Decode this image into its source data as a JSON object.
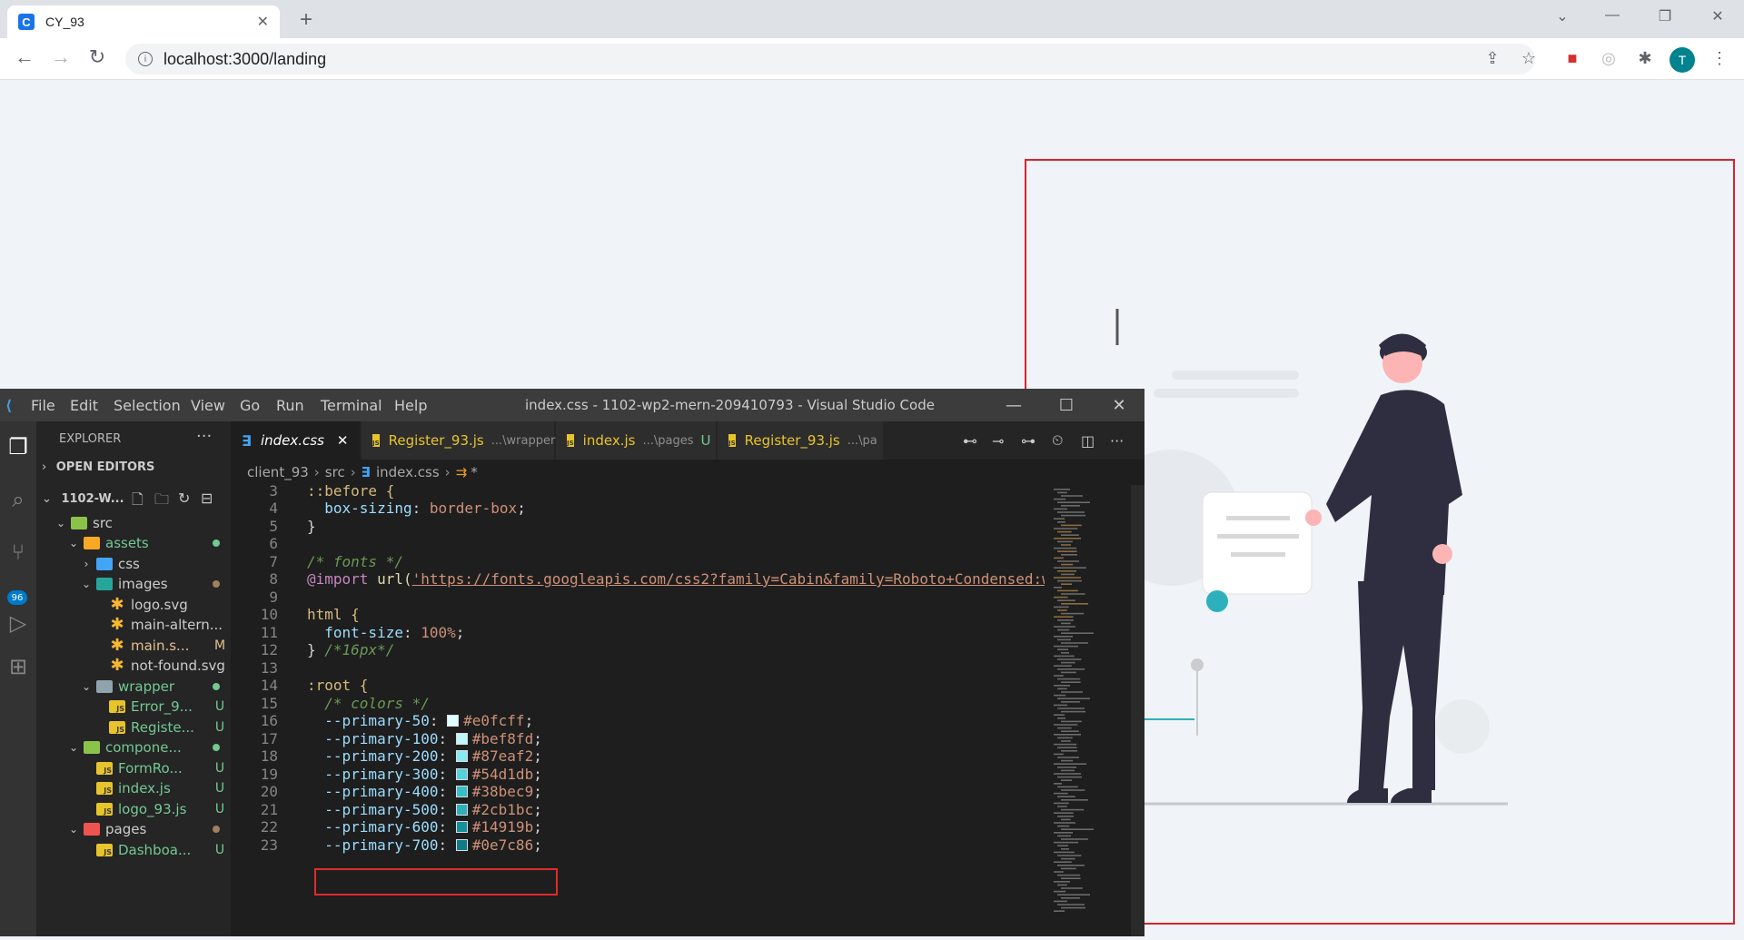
{
  "browser": {
    "tab_title": "CY_93",
    "favicon_letter": "C",
    "url": "localhost:3000/landing",
    "profile_initial": "T"
  },
  "vscode": {
    "menu": [
      "File",
      "Edit",
      "Selection",
      "View",
      "Go",
      "Run",
      "Terminal",
      "Help"
    ],
    "window_title": "index.css - 1102-wp2-mern-209410793 - Visual Studio Code",
    "source_control_badge": "96",
    "explorer_title": "EXPLORER",
    "open_editors_label": "OPEN EDITORS",
    "workspace_label": "1102-W...",
    "tree": [
      {
        "label": "src",
        "indent": 1,
        "type": "folder-open"
      },
      {
        "label": "assets",
        "indent": 2,
        "type": "folder-open",
        "status": "dot",
        "status_color": "#73c991"
      },
      {
        "label": "css",
        "indent": 3,
        "type": "folder-closed"
      },
      {
        "label": "images",
        "indent": 3,
        "type": "folder-open",
        "status": "dot",
        "status_color": "#a08060"
      },
      {
        "label": "logo.svg",
        "indent": 4,
        "type": "svg"
      },
      {
        "label": "main-altern...",
        "indent": 4,
        "type": "svg"
      },
      {
        "label": "main.s...",
        "indent": 4,
        "type": "svg",
        "status": "M",
        "status_color": "#e2c08d"
      },
      {
        "label": "not-found.svg",
        "indent": 4,
        "type": "svg"
      },
      {
        "label": "wrapper",
        "indent": 3,
        "type": "folder-open",
        "status": "dot",
        "status_color": "#73c991"
      },
      {
        "label": "Error_9...",
        "indent": 4,
        "type": "js",
        "status": "U",
        "status_color": "#73c991"
      },
      {
        "label": "Registe...",
        "indent": 4,
        "type": "js",
        "status": "U",
        "status_color": "#73c991"
      },
      {
        "label": "compone...",
        "indent": 2,
        "type": "folder-open",
        "status": "dot",
        "status_color": "#73c991"
      },
      {
        "label": "FormRo...",
        "indent": 3,
        "type": "js",
        "status": "U",
        "status_color": "#73c991"
      },
      {
        "label": "index.js",
        "indent": 3,
        "type": "js",
        "status": "U",
        "status_color": "#73c991"
      },
      {
        "label": "logo_93.js",
        "indent": 3,
        "type": "js",
        "status": "U",
        "status_color": "#73c991"
      },
      {
        "label": "pages",
        "indent": 2,
        "type": "folder-open",
        "status": "dot",
        "status_color": "#a08060"
      },
      {
        "label": "Dashboa...",
        "indent": 3,
        "type": "js",
        "status": "U",
        "status_color": "#73c991"
      }
    ],
    "tabs": [
      {
        "label": "index.css",
        "path": "",
        "status": "",
        "active": true
      },
      {
        "label": "Register_93.js",
        "path": "...\\wrapper",
        "status": "U",
        "active": false
      },
      {
        "label": "index.js",
        "path": "...\\pages",
        "status": "U",
        "active": false
      },
      {
        "label": "Register_93.js",
        "path": "...\\pa",
        "status": "",
        "active": false
      }
    ],
    "breadcrumb": [
      "client_93",
      "src",
      "index.css",
      "*"
    ],
    "code": {
      "line_numbers": [
        "3",
        "4",
        "5",
        "6",
        "7",
        "8",
        "9",
        "10",
        "11",
        "12",
        "13",
        "14",
        "15",
        "16",
        "17",
        "18",
        "19",
        "20",
        "21",
        "22",
        "23"
      ],
      "l3": "::before {",
      "l4_prop": "box-sizing",
      "l4_val": "border-box",
      "l5": "}",
      "l7": "/* fonts */",
      "l8_at": "@import",
      "l8_fn": "url(",
      "l8_str": "'https://fonts.googleapis.com/css2?family=Cabin&family=Roboto+Condensed:w",
      "l10": "html {",
      "l11_prop": "font-size",
      "l11_val": "100%",
      "l12_brace": "}",
      "l12_com": "/*16px*/",
      "l14": ":root {",
      "l15": "/* colors */",
      "colors": [
        {
          "name": "--primary-50",
          "value": "#e0fcff"
        },
        {
          "name": "--primary-100",
          "value": "#bef8fd"
        },
        {
          "name": "--primary-200",
          "value": "#87eaf2"
        },
        {
          "name": "--primary-300",
          "value": "#54d1db"
        },
        {
          "name": "--primary-400",
          "value": "#38bec9"
        },
        {
          "name": "--primary-500",
          "value": "#2cb1bc"
        },
        {
          "name": "--primary-600",
          "value": "#14919b"
        },
        {
          "name": "--primary-700",
          "value": "#0e7c86"
        }
      ]
    }
  },
  "colors": {
    "accent_teal": "#2cb1bc",
    "annotation_red": "#d9232e"
  }
}
